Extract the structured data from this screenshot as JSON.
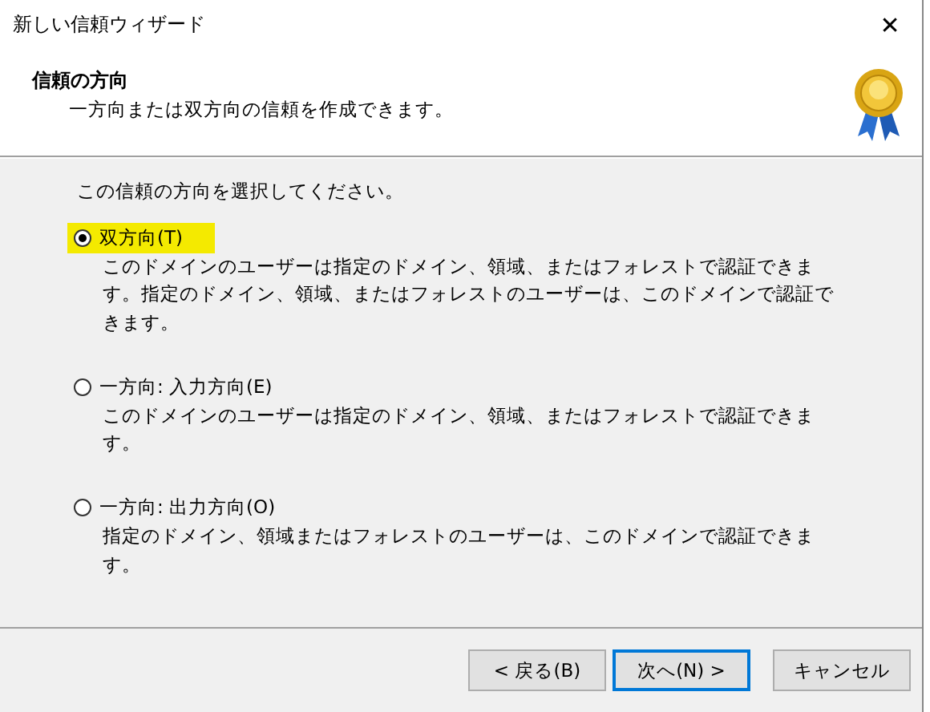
{
  "window": {
    "title": "新しい信頼ウィザード",
    "close": "✕"
  },
  "header": {
    "title": "信頼の方向",
    "subtitle": "一方向または双方向の信頼を作成できます。"
  },
  "prompt": "この信頼の方向を選択してください。",
  "options": [
    {
      "label": "双方向(T)",
      "selected": true,
      "highlighted": true,
      "description": "このドメインのユーザーは指定のドメイン、領域、またはフォレストで認証できます。指定のドメイン、領域、またはフォレストのユーザーは、このドメインで認証できます。"
    },
    {
      "label": "一方向: 入力方向(E)",
      "selected": false,
      "highlighted": false,
      "description": "このドメインのユーザーは指定のドメイン、領域、またはフォレストで認証できます。"
    },
    {
      "label": "一方向: 出力方向(O)",
      "selected": false,
      "highlighted": false,
      "description": "指定のドメイン、領域またはフォレストのユーザーは、このドメインで認証できます。"
    }
  ],
  "buttons": [
    {
      "label": "< 戻る(B)",
      "default": false
    },
    {
      "label": "次へ(N) >",
      "default": true
    },
    {
      "label": "キャンセル",
      "default": false
    }
  ]
}
